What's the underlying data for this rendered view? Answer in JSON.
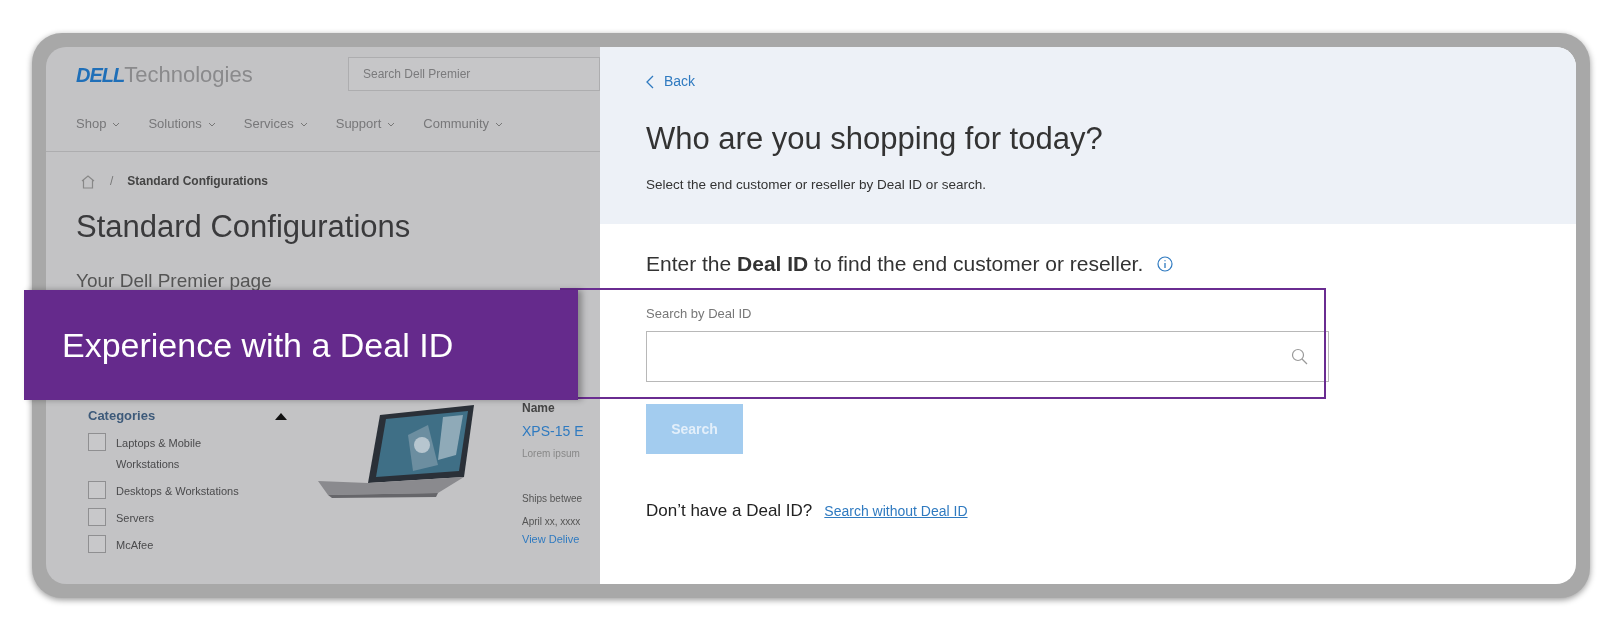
{
  "background_page": {
    "logo": {
      "brand": "DELL",
      "product": "Technologies"
    },
    "search": {
      "placeholder": "Search Dell Premier"
    },
    "nav": [
      "Shop",
      "Solutions",
      "Services",
      "Support",
      "Community"
    ],
    "breadcrumb": {
      "separator": "/",
      "current": "Standard Configurations"
    },
    "title": "Standard Configurations",
    "subtitle": "Your Dell Premier page",
    "categories": {
      "heading": "Categories",
      "expanded": true,
      "items": [
        {
          "label": "Laptops & Mobile Workstations",
          "checked": false
        },
        {
          "label": "Desktops & Workstations",
          "checked": false
        },
        {
          "label": "Servers",
          "checked": false
        },
        {
          "label": "McAfee",
          "checked": false
        }
      ]
    },
    "product": {
      "name_heading": "Name",
      "name": "XPS-15 E",
      "description": "Lorem ipsum",
      "ships_label": "Ships betwee",
      "ships_date": "April xx, xxxx",
      "link": "View Delive"
    }
  },
  "dialog": {
    "back": "Back",
    "title": "Who are you shopping for today?",
    "subtitle": "Select the end customer or reseller by Deal ID or search.",
    "prompt": "Enter the **Deal ID** to find the end customer or reseller.",
    "field": {
      "label": "Search by Deal ID"
    },
    "button": {
      "label": "Search",
      "disabled": true
    },
    "footer": {
      "text": "Don’t have a Deal ID?",
      "link": "Search without Deal ID"
    }
  },
  "banner": {
    "text": "Experience with a Deal ID"
  }
}
